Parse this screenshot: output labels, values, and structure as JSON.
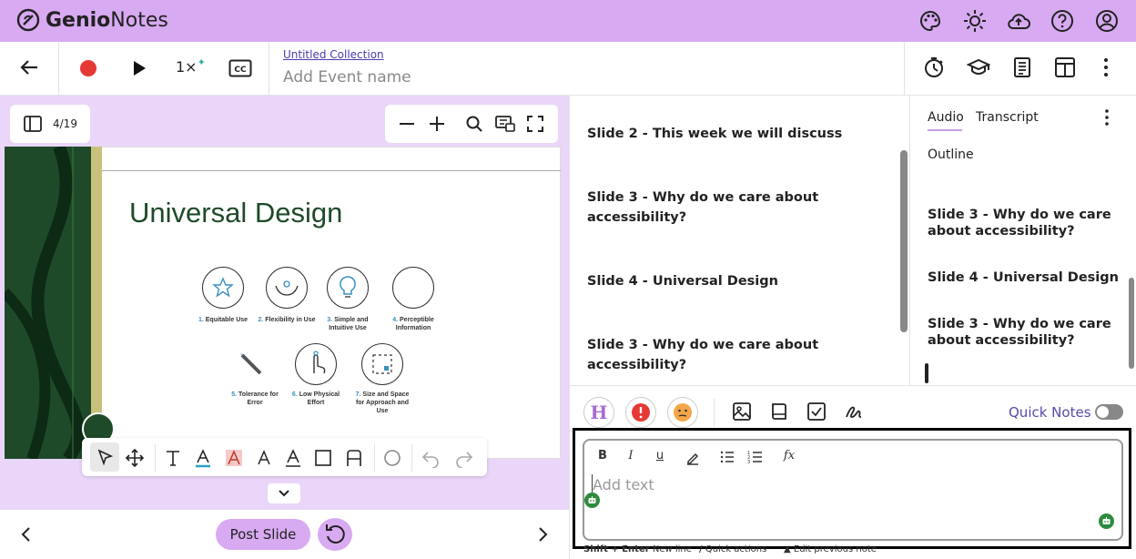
{
  "app": {
    "brand_part1": "Genio",
    "brand_part2": "Notes"
  },
  "topbar": {
    "icons": [
      "palette-icon",
      "brightness-icon",
      "cloud-upload-icon",
      "help-icon",
      "account-icon"
    ]
  },
  "player": {
    "speed": "1×",
    "collection": "Untitled Collection",
    "event_placeholder": "Add Event name"
  },
  "right_toolbar_icons": [
    "timer-icon",
    "graduation-cap-icon",
    "notes-icon",
    "layout-icon",
    "more-vert-icon"
  ],
  "slide_panel": {
    "page_indicator": "4/19",
    "slide_title": "Universal Design",
    "principles": [
      {
        "num": "1.",
        "text": "Equitable Use"
      },
      {
        "num": "2.",
        "text": "Flexibility in Use"
      },
      {
        "num": "3.",
        "text": "Simple and Intuitive Use"
      },
      {
        "num": "4.",
        "text": "Perceptible Information"
      },
      {
        "num": "5.",
        "text": "Tolerance for Error"
      },
      {
        "num": "6.",
        "text": "Low Physical Effort"
      },
      {
        "num": "7.",
        "text": "Size and Space for Approach and Use"
      }
    ],
    "post_slide_label": "Post Slide"
  },
  "middle_notes": [
    "Slide 2 - This week we will discuss",
    "Slide 3 - Why do we care about accessibility?",
    "Slide 4 - Universal Design",
    "Slide 3 - Why do we care about accessibility?"
  ],
  "right_panel": {
    "tabs": [
      "Audio",
      "Transcript"
    ],
    "active_tab": "Audio",
    "outline_label": "Outline",
    "items": [
      "Slide 3 - Why do we care about accessibility?",
      "Slide 4 - Universal Design",
      "Slide 3 - Why do we care about accessibility?"
    ]
  },
  "quick_notes": {
    "label": "Quick Notes",
    "toggle_on": false,
    "heading_button": "H",
    "editor_placeholder": "Add text",
    "hints": [
      {
        "key": "Shift + Enter",
        "text": "New line"
      },
      {
        "key": "/",
        "text": "Quick actions"
      },
      {
        "key": "▲",
        "text": "Edit previous note"
      }
    ]
  },
  "colors": {
    "brand": "#d8aaf2",
    "panel": "#ead6f9",
    "record": "#e53935",
    "slide_green": "#1f4a2a"
  }
}
